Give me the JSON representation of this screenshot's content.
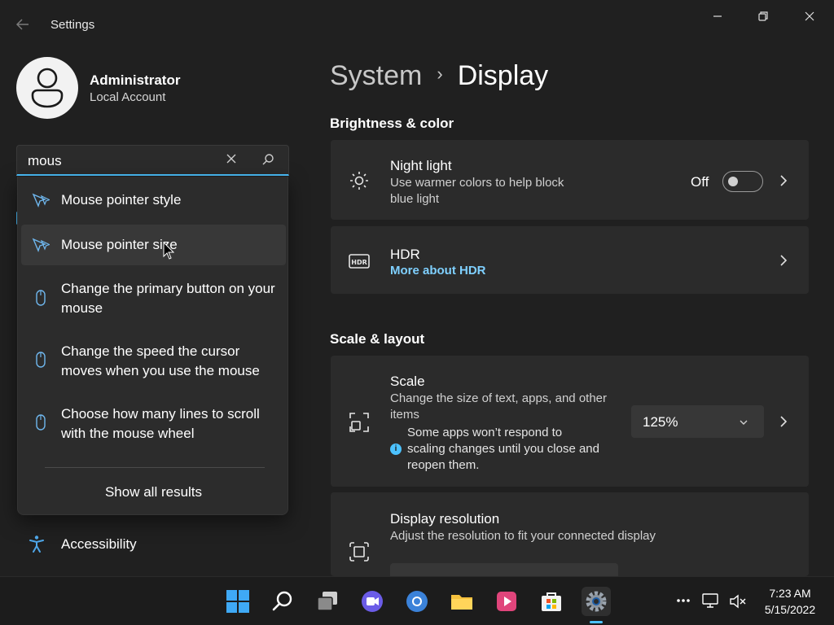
{
  "window": {
    "title": "Settings"
  },
  "account": {
    "name": "Administrator",
    "type": "Local Account"
  },
  "search": {
    "value": "mous",
    "results": [
      {
        "label": "Mouse pointer style",
        "icon": "mouse-pointer-icon"
      },
      {
        "label": "Mouse pointer size",
        "icon": "mouse-pointer-icon"
      },
      {
        "label": "Change the primary button on your mouse",
        "icon": "mouse-icon"
      },
      {
        "label": "Change the speed the cursor moves when you use the mouse",
        "icon": "mouse-icon"
      },
      {
        "label": "Choose how many lines to scroll with the mouse wheel",
        "icon": "mouse-icon"
      }
    ],
    "show_all": "Show all results"
  },
  "nav": {
    "accessibility": "Accessibility"
  },
  "breadcrumb": {
    "parent": "System",
    "current": "Display"
  },
  "sections": {
    "brightness": "Brightness & color",
    "scale_layout": "Scale & layout"
  },
  "night_light": {
    "title": "Night light",
    "desc": "Use warmer colors to help block blue light",
    "state": "Off"
  },
  "hdr": {
    "title": "HDR",
    "link": "More about HDR",
    "icon_label": "HDR"
  },
  "scale": {
    "title": "Scale",
    "desc": "Change the size of text, apps, and other items",
    "note": "Some apps won’t respond to scaling changes until you close and reopen them.",
    "value": "125%"
  },
  "resolution": {
    "title": "Display resolution",
    "desc": "Adjust the resolution to fit your connected display"
  },
  "taskbar": {
    "time": "7:23 AM",
    "date": "5/15/2022"
  },
  "colors": {
    "accent": "#4cc2ff",
    "background": "#202020",
    "card": "#2b2b2b",
    "link": "#7fd0ff"
  }
}
